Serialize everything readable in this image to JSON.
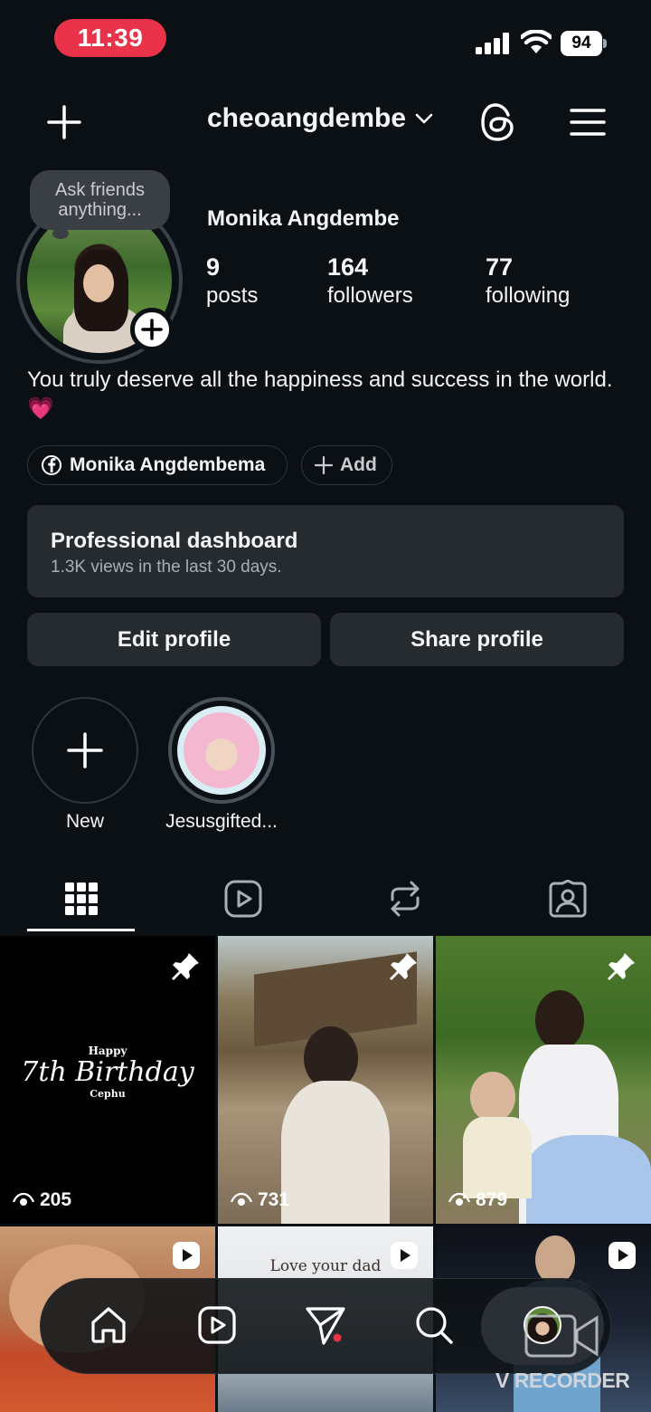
{
  "status_bar": {
    "time": "11:39",
    "battery": "94"
  },
  "header": {
    "username": "cheoangdembe"
  },
  "profile": {
    "note": "Ask friends anything...",
    "full_name": "Monika Angdembe",
    "stats": [
      {
        "value": "9",
        "label": "posts"
      },
      {
        "value": "164",
        "label": "followers"
      },
      {
        "value": "77",
        "label": "following"
      }
    ],
    "bio": "You truly deserve all the happiness and success in the world. 💗",
    "link_label": "Monika Angdembema",
    "add_label": "Add"
  },
  "dashboard": {
    "title": "Professional dashboard",
    "subtitle": "1.3K views in the last 30 days."
  },
  "buttons": {
    "edit": "Edit profile",
    "share": "Share profile"
  },
  "highlights": [
    {
      "label": "New"
    },
    {
      "label": "Jesusgifted..."
    }
  ],
  "grid": {
    "first_post_text": {
      "line1": "Happy",
      "line2": "7th Birthday",
      "line3": "Cephu"
    },
    "second_row_text": "Love your dad",
    "views": [
      "205",
      "731",
      "879"
    ]
  },
  "watermark": "V RECORDER"
}
